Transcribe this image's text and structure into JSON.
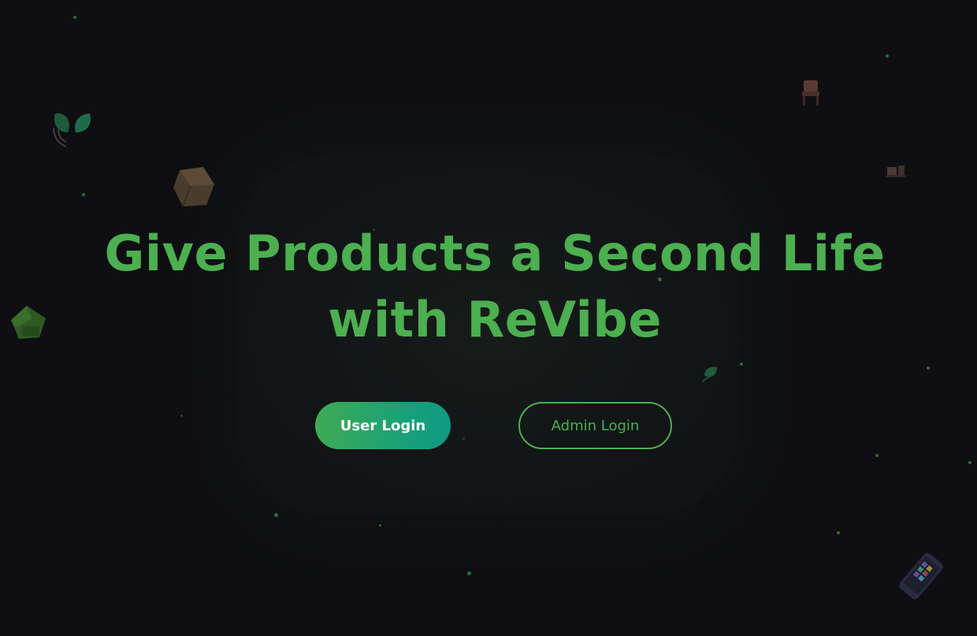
{
  "hero": {
    "title_line1": "Give Products a Second Life",
    "title_line2": "with ReVibe"
  },
  "buttons": {
    "user_login": "User Login",
    "admin_login": "Admin Login"
  },
  "decorations": [
    "leaf-icon",
    "cardboard-box-icon",
    "green-hat-icon",
    "chair-icon",
    "small-leaf-icon",
    "smartphone-icon",
    "small-chair-icon"
  ],
  "colors": {
    "accent": "#4caf50",
    "background": "#0f0f13",
    "button_gradient_start": "#3faa55",
    "button_gradient_end": "#0f9a85"
  }
}
